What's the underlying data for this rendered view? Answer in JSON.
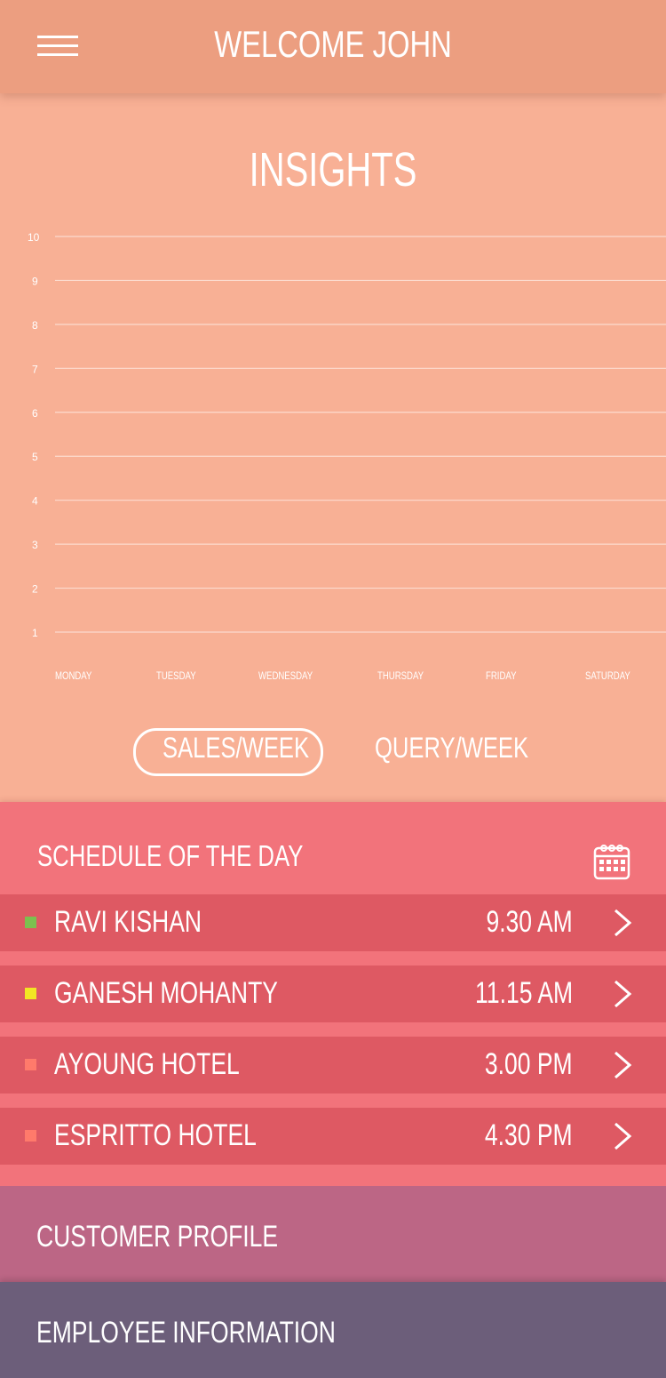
{
  "header": {
    "title": "WELCOME JOHN",
    "menu_icon": "hamburger-menu-icon"
  },
  "insights": {
    "title": "INSIGHTS",
    "tabs": [
      {
        "label": "SALES/WEEK",
        "active": true
      },
      {
        "label": "QUERY/WEEK",
        "active": false
      }
    ]
  },
  "chart_data": {
    "type": "line",
    "categories": [
      "MONDAY",
      "TUESDAY",
      "WEDNESDAY",
      "THURSDAY",
      "FRIDAY",
      "SATURDAY"
    ],
    "yticks": [
      1,
      2,
      3,
      4,
      5,
      6,
      7,
      8,
      9,
      10
    ],
    "ylim": [
      1,
      10
    ],
    "series": [],
    "grid": true,
    "title": "",
    "xlabel": "",
    "ylabel": ""
  },
  "schedule": {
    "title": "SCHEDULE OF THE DAY",
    "calendar_icon": "calendar-icon",
    "items": [
      {
        "name": "RAVI KISHAN",
        "time": "9.30 AM",
        "status_color": "#7cc04f"
      },
      {
        "name": "GANESH MOHANTY",
        "time": "11.15 AM",
        "status_color": "#f2e624"
      },
      {
        "name": "AYOUNG HOTEL",
        "time": "3.00 PM",
        "status_color": "#ff7a6b"
      },
      {
        "name": "ESPRITTO HOTEL",
        "time": "4.30 PM",
        "status_color": "#ff7a6b"
      }
    ]
  },
  "sections": {
    "customer_profile": "CUSTOMER PROFILE",
    "employee_information": "EMPLOYEE INFORMATION"
  },
  "colors": {
    "header_bg": "#ec9e80",
    "insights_bg": "#f8b095",
    "schedule_bg": "#f2737b",
    "schedule_row_bg": "#de5963",
    "customer_bg": "#bc6685",
    "employee_bg": "#6c5e7a"
  }
}
